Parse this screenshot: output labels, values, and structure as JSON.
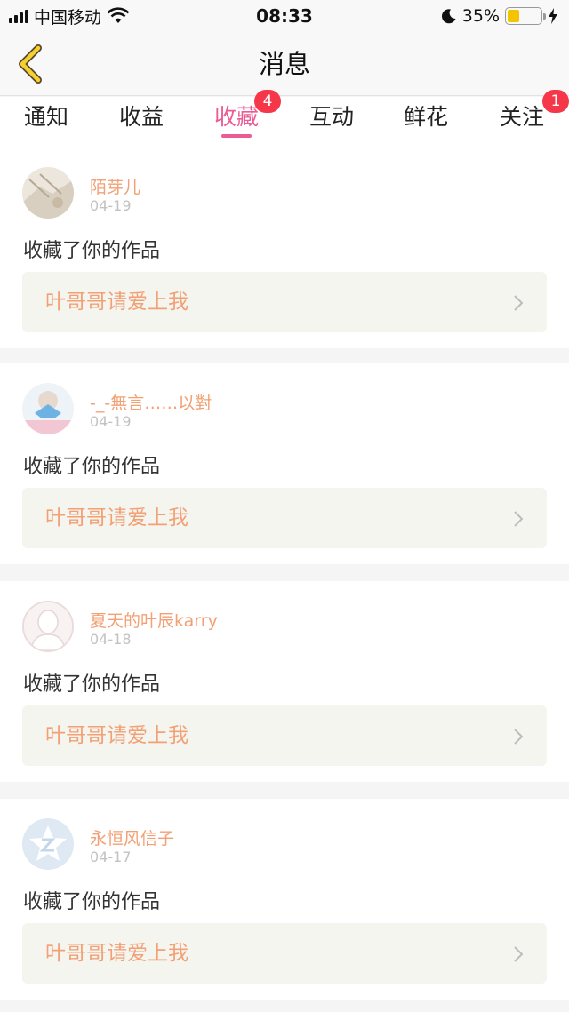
{
  "status_bar": {
    "carrier": "中国移动",
    "time": "08:33",
    "battery_percent": "35%",
    "battery_level": 0.35
  },
  "nav": {
    "title": "消息"
  },
  "tabs": [
    {
      "label": "通知",
      "badge": ""
    },
    {
      "label": "收益",
      "badge": ""
    },
    {
      "label": "收藏",
      "badge": "4"
    },
    {
      "label": "互动",
      "badge": ""
    },
    {
      "label": "鲜花",
      "badge": ""
    },
    {
      "label": "关注",
      "badge": "1"
    }
  ],
  "active_tab": "收藏",
  "colors": {
    "accent_pink": "#ea5c93",
    "username_orange": "#f2a074",
    "badge_red": "#f6374a"
  },
  "messages": [
    {
      "username": "陌芽儿",
      "date": "04-19",
      "action": "收藏了你的作品",
      "work_title": "叶哥哥请爱上我",
      "avatar_icon": "photo-avatar-icon"
    },
    {
      "username": "-_-無言……以對",
      "date": "04-19",
      "action": "收藏了你的作品",
      "work_title": "叶哥哥请爱上我",
      "avatar_icon": "photo-avatar-icon"
    },
    {
      "username": "夏天的叶辰karry",
      "date": "04-18",
      "action": "收藏了你的作品",
      "work_title": "叶哥哥请爱上我",
      "avatar_icon": "default-user-avatar-icon"
    },
    {
      "username": "永恒风信子",
      "date": "04-17",
      "action": "收藏了你的作品",
      "work_title": "叶哥哥请爱上我",
      "avatar_icon": "qq-avatar-icon"
    }
  ]
}
